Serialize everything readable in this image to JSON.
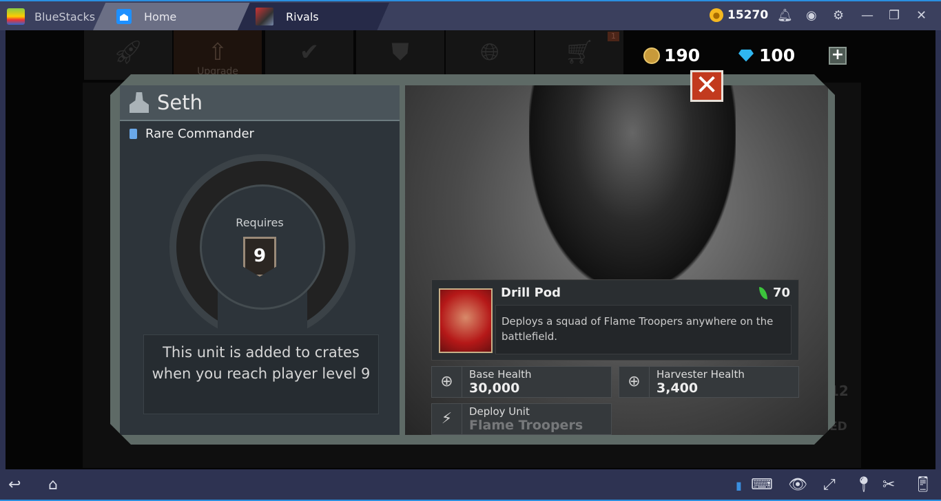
{
  "titlebar": {
    "app": "BlueStacks",
    "tabs": [
      {
        "label": "Home"
      },
      {
        "label": "Rivals"
      }
    ],
    "coins": "15270"
  },
  "game": {
    "nav": [
      {
        "icon": "rocket-icon"
      },
      {
        "icon": "upgrade-icon",
        "label": "Upgrade"
      },
      {
        "icon": "achievement-icon"
      },
      {
        "icon": "alliance-icon"
      },
      {
        "icon": "globe-icon"
      },
      {
        "icon": "cart-icon",
        "badge": "1"
      }
    ],
    "gold": "190",
    "gems": "100",
    "background_text": [
      "12",
      "ED"
    ],
    "commander": {
      "name": "Seth",
      "rarity": "Rare Commander",
      "requires_label": "Requires",
      "required_level": "9",
      "message": "This unit is added to crates when you reach player level 9"
    },
    "ability": {
      "name": "Drill Pod",
      "cost": "70",
      "description": "Deploys a squad of Flame Troopers anywhere on the battlefield."
    },
    "stats": [
      {
        "label": "Base Health",
        "value": "30,000"
      },
      {
        "label": "Harvester Health",
        "value": "3,400"
      },
      {
        "label": "Deploy Unit",
        "value": "Flame Troopers"
      }
    ]
  },
  "colors": {
    "accent": "#2a8fe0",
    "close": "#c23a1e",
    "frame": "#5e6a66"
  }
}
